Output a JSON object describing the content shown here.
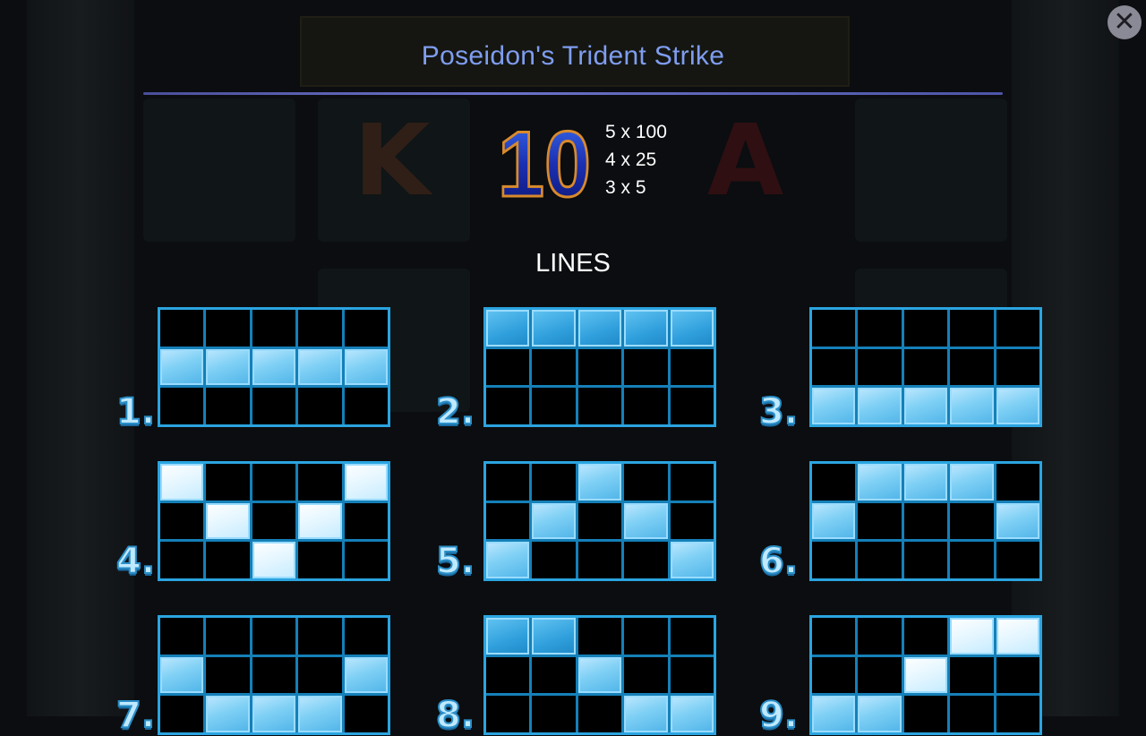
{
  "title": "Poseidon's Trident Strike",
  "close_label": "✕",
  "symbol": {
    "label": "10",
    "name": "ten-symbol",
    "pays": [
      "5 x 100",
      "4 x 25",
      "3 x 5"
    ]
  },
  "lines_heading": "LINES",
  "lines": [
    {
      "label": "1.",
      "pattern": [
        1,
        1,
        1,
        1,
        1
      ]
    },
    {
      "label": "2.",
      "pattern": [
        0,
        0,
        0,
        0,
        0
      ]
    },
    {
      "label": "3.",
      "pattern": [
        2,
        2,
        2,
        2,
        2
      ]
    },
    {
      "label": "4.",
      "pattern": [
        0,
        1,
        2,
        1,
        0
      ]
    },
    {
      "label": "5.",
      "pattern": [
        2,
        1,
        0,
        1,
        2
      ]
    },
    {
      "label": "6.",
      "pattern": [
        1,
        0,
        0,
        0,
        1
      ]
    },
    {
      "label": "7.",
      "pattern": [
        1,
        2,
        2,
        2,
        1
      ]
    },
    {
      "label": "8.",
      "pattern": [
        0,
        0,
        1,
        2,
        2
      ]
    },
    {
      "label": "9.",
      "pattern": [
        2,
        2,
        1,
        0,
        0
      ]
    }
  ],
  "colors": {
    "title": "#7f9df0",
    "grid_border": "#2ba4e0",
    "cell_active": "#7fd0f5",
    "number_fill": "#bfe9ff"
  }
}
